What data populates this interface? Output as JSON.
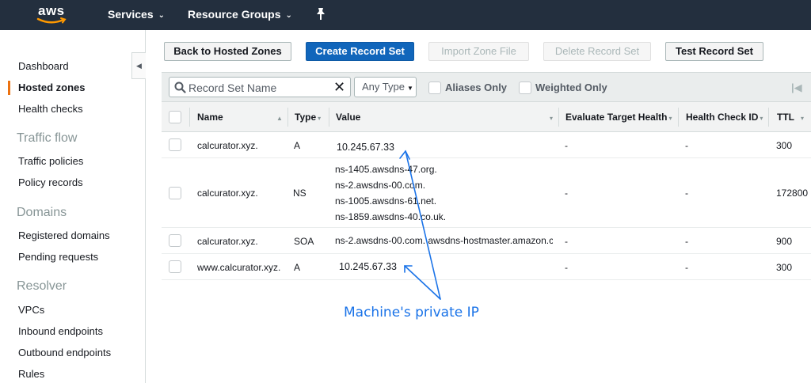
{
  "topnav": {
    "logo_text": "aws",
    "services_label": "Services",
    "resource_groups_label": "Resource Groups"
  },
  "sidebar": {
    "items": [
      {
        "label": "Dashboard"
      },
      {
        "label": "Hosted zones",
        "active": true
      },
      {
        "label": "Health checks"
      }
    ],
    "sections": [
      {
        "title": "Traffic flow",
        "items": [
          {
            "label": "Traffic policies"
          },
          {
            "label": "Policy records"
          }
        ]
      },
      {
        "title": "Domains",
        "items": [
          {
            "label": "Registered domains"
          },
          {
            "label": "Pending requests"
          }
        ]
      },
      {
        "title": "Resolver",
        "items": [
          {
            "label": "VPCs"
          },
          {
            "label": "Inbound endpoints"
          },
          {
            "label": "Outbound endpoints"
          },
          {
            "label": "Rules"
          }
        ]
      }
    ],
    "accent_color": "#ec7211"
  },
  "toolbar": {
    "back_label": "Back to Hosted Zones",
    "create_label": "Create Record Set",
    "import_label": "Import Zone File",
    "delete_label": "Delete Record Set",
    "test_label": "Test Record Set"
  },
  "filter": {
    "search_placeholder": "Record Set Name",
    "type_select": "Any Type",
    "aliases_label": "Aliases Only",
    "weighted_label": "Weighted Only"
  },
  "table": {
    "headers": {
      "name": "Name",
      "type": "Type",
      "value": "Value",
      "evaluate": "Evaluate Target Health",
      "healthcheck": "Health Check ID",
      "ttl": "TTL"
    },
    "rows": [
      {
        "name": "calcurator.xyz.",
        "type": "A",
        "values": [
          "10.245.67.33"
        ],
        "evaluate": "-",
        "healthcheck": "-",
        "ttl": "300"
      },
      {
        "name": "calcurator.xyz.",
        "type": "NS",
        "values": [
          "ns-1405.awsdns-47.org.",
          "ns-2.awsdns-00.com.",
          "ns-1005.awsdns-61.net.",
          "ns-1859.awsdns-40.co.uk."
        ],
        "evaluate": "-",
        "healthcheck": "-",
        "ttl": "172800"
      },
      {
        "name": "calcurator.xyz.",
        "type": "SOA",
        "values": [
          "ns-2.awsdns-00.com. awsdns-hostmaster.amazon.c"
        ],
        "evaluate": "-",
        "healthcheck": "-",
        "ttl": "900"
      },
      {
        "name": "www.calcurator.xyz.",
        "type": "A",
        "values": [
          "10.245.67.33"
        ],
        "evaluate": "-",
        "healthcheck": "-",
        "ttl": "300"
      }
    ]
  },
  "annotation": {
    "text": "Machine's private IP",
    "color": "#1a73e8"
  },
  "colors": {
    "topnav_bg": "#232f3e",
    "primary_button": "#1166bb"
  }
}
